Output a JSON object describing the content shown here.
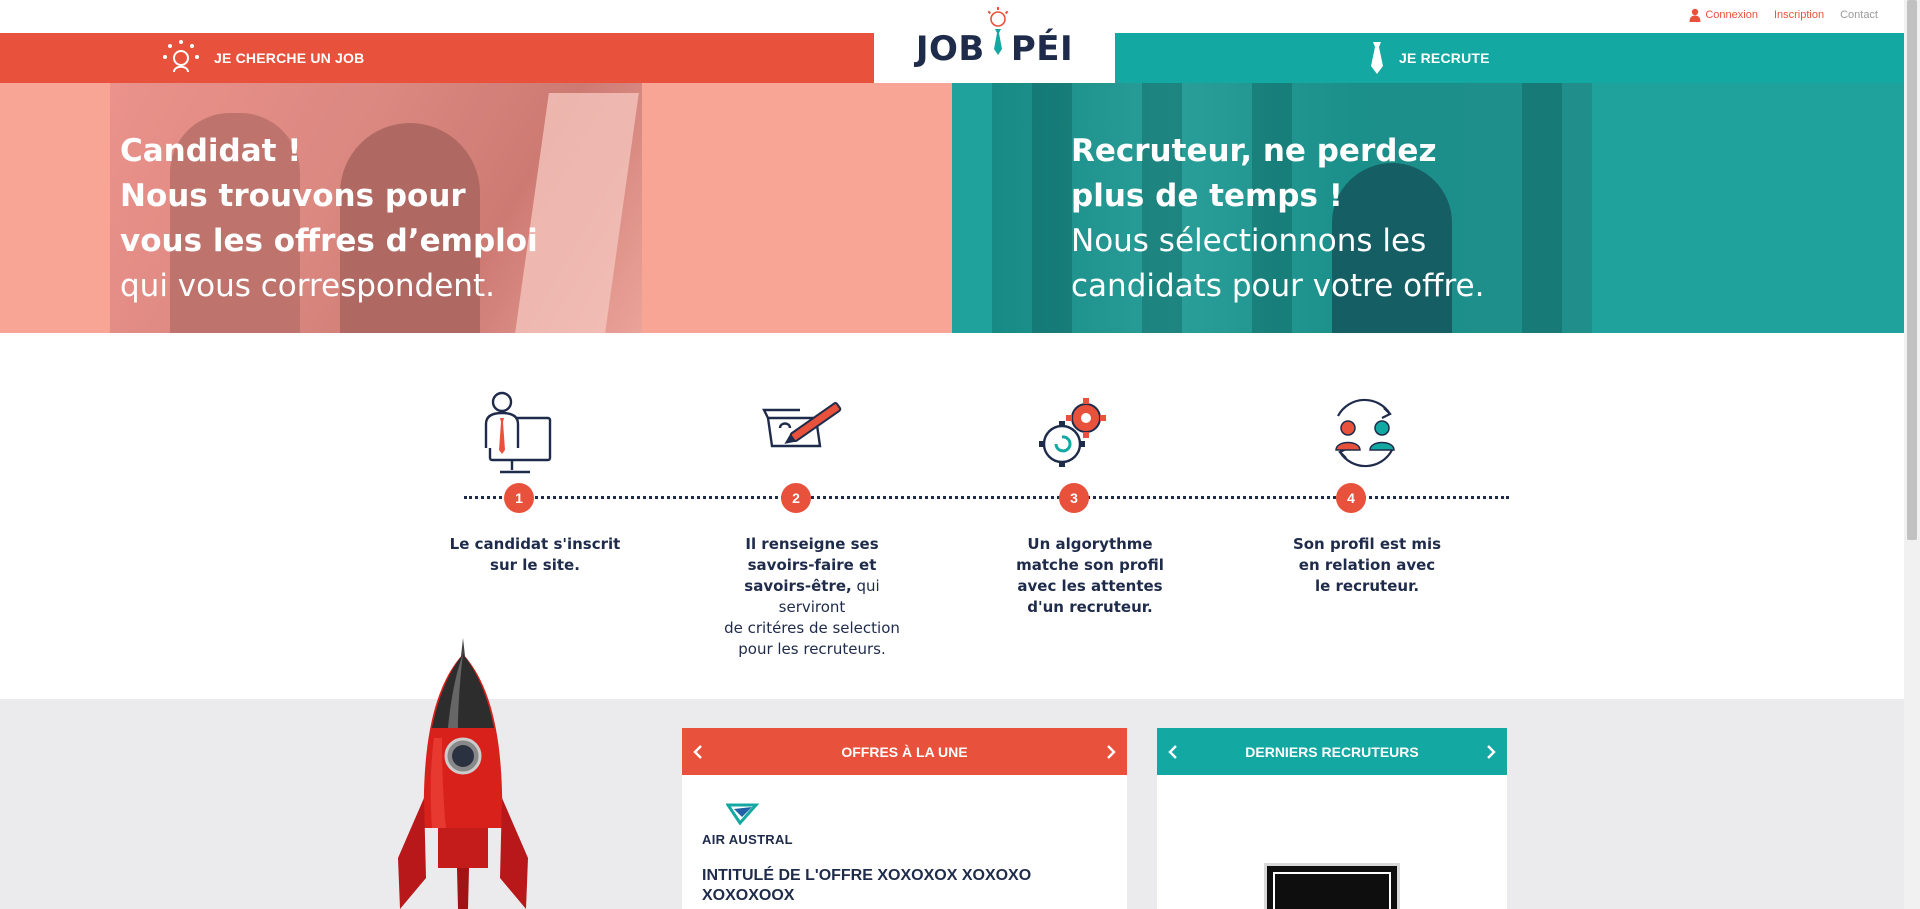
{
  "toplinks": {
    "connexion": "Connexion",
    "inscription": "Inscription",
    "contact": "Contact"
  },
  "nav": {
    "candidate_label": "JE CHERCHE UN JOB",
    "recruiter_label": "JE RECRUTE",
    "logo_left": "JOB",
    "logo_right": "PÉI"
  },
  "hero": {
    "left": {
      "l1": "Candidat !",
      "l2": "Nous trouvons pour",
      "l3": "vous les offres d’emploi",
      "l4": "qui vous correspondent."
    },
    "right": {
      "l1": "Recruteur, ne perdez",
      "l2": "plus de temps !",
      "l3": "Nous sélectionnons les",
      "l4": "candidats pour votre offre."
    }
  },
  "steps": [
    {
      "num": "1",
      "icon": "candidate-computer-icon",
      "b1": "Le candidat s'inscrit",
      "b2": "sur le site."
    },
    {
      "num": "2",
      "icon": "toolbox-pen-icon",
      "b1": "Il renseigne ses",
      "b2": "savoirs-faire et",
      "b3": "savoirs-être,",
      "n1": " qui serviront",
      "n2": "de critéres de selection",
      "n3": "pour les recruteurs."
    },
    {
      "num": "3",
      "icon": "gears-algorithm-icon",
      "b1": "Un algorythme",
      "b2": "matche son profil",
      "b3": "avec les attentes",
      "b4": "d'un recruteur."
    },
    {
      "num": "4",
      "icon": "match-people-icon",
      "b1": "Son profil est mis",
      "b2": "en relation avec",
      "b3": "le recruteur."
    }
  ],
  "offres": {
    "title": "OFFRES À LA UNE",
    "company": "AIR AUSTRAL",
    "offer_title": "INTITULÉ DE L'OFFRE XOXOXOX XOXOXO XOXOXOOX"
  },
  "recruteurs": {
    "title": "DERNIERS RECRUTEURS"
  },
  "colors": {
    "brand_red": "#e8523c",
    "brand_teal": "#14a8a3",
    "navy": "#1f2b4a"
  }
}
